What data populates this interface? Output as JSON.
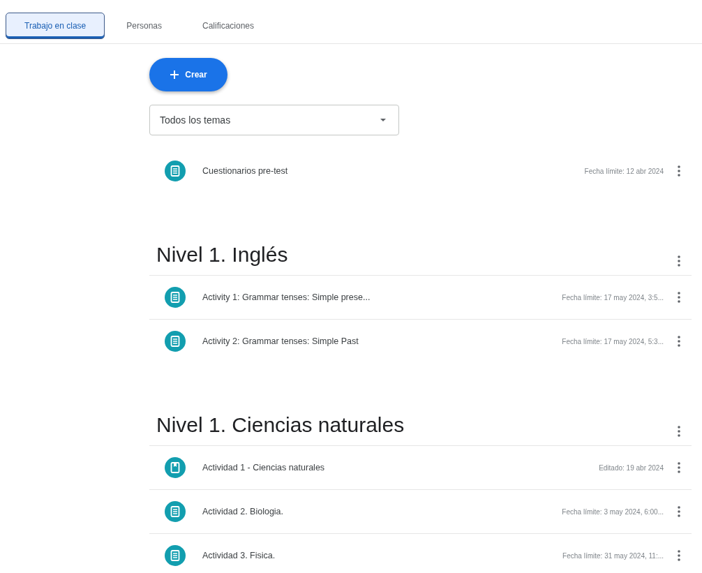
{
  "tabs": [
    {
      "label": "Trabajo en clase",
      "selected": true
    },
    {
      "label": "Personas",
      "selected": false
    },
    {
      "label": "Calificaciones",
      "selected": false
    }
  ],
  "create_button": {
    "label": "Crear"
  },
  "topic_filter": {
    "value": "Todos los temas"
  },
  "ungrouped": [
    {
      "kind": "assignment",
      "title": "Cuestionarios pre-test",
      "meta": "Fecha límite: 12 abr 2024"
    }
  ],
  "topics": [
    {
      "title": "Nivel 1. Inglés",
      "items": [
        {
          "kind": "assignment",
          "title": "Activity 1: Grammar tenses: Simple prese...",
          "meta": "Fecha límite: 17 may 2024, 3:5..."
        },
        {
          "kind": "assignment",
          "title": "Activity 2: Grammar tenses: Simple Past",
          "meta": "Fecha límite: 17 may 2024, 5:3..."
        }
      ]
    },
    {
      "title": "Nivel 1. Ciencias naturales",
      "items": [
        {
          "kind": "material",
          "title": "Actividad 1 - Ciencias naturales",
          "meta": "Editado: 19 abr 2024"
        },
        {
          "kind": "assignment",
          "title": "Actividad 2. Biologia.",
          "meta": "Fecha límite: 3 may 2024, 6:00..."
        },
        {
          "kind": "assignment",
          "title": "Actividad 3. Fisica.",
          "meta": "Fecha límite: 31 may 2024, 11:..."
        }
      ]
    }
  ]
}
